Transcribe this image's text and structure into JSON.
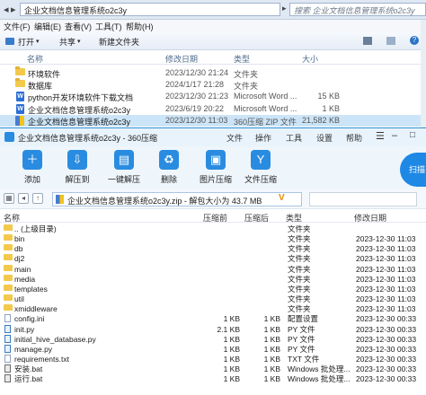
{
  "explorer": {
    "path": "企业文档信息管理系统o2c3y",
    "search_placeholder": "搜索 企业文档信息管理系统o2c3y",
    "menu": [
      "文件(F)",
      "编辑(E)",
      "查看(V)",
      "工具(T)",
      "帮助(H)"
    ],
    "toolbar": {
      "open": "打开",
      "share": "共享",
      "new_folder": "新建文件夹"
    },
    "columns": {
      "name": "名称",
      "date": "修改日期",
      "type": "类型",
      "size": "大小"
    },
    "rows": [
      {
        "name": "环境软件",
        "date": "2023/12/30 21:24",
        "type": "文件夹",
        "size": "",
        "icon": "folder-icon"
      },
      {
        "name": "数据库",
        "date": "2024/1/17 21:28",
        "type": "文件夹",
        "size": "",
        "icon": "folder-icon"
      },
      {
        "name": "python开发环境软件下载文档",
        "date": "2023/12/30 21:23",
        "type": "Microsoft Word ...",
        "size": "15 KB",
        "icon": "word-icon"
      },
      {
        "name": "企业文档信息管理系统o2c3y",
        "date": "2023/6/19 20:22",
        "type": "Microsoft Word ...",
        "size": "1 KB",
        "icon": "word-icon"
      },
      {
        "name": "企业文档信息管理系统o2c3y",
        "date": "2023/12/30 11:03",
        "type": "360压缩 ZIP 文件",
        "size": "21,582 KB",
        "icon": "zip-icon",
        "selected": true
      }
    ]
  },
  "zip": {
    "title": "企业文档信息管理系统o2c3y - 360压缩",
    "menu": [
      "文件",
      "操作",
      "工具",
      "设置",
      "帮助"
    ],
    "tools": [
      {
        "label": "添加",
        "icon": "add-icon"
      },
      {
        "label": "解压到",
        "icon": "extract-to-icon"
      },
      {
        "label": "一键解压",
        "icon": "one-click-extract-icon"
      },
      {
        "label": "删除",
        "icon": "delete-icon"
      },
      {
        "label": "图片压缩",
        "icon": "image-compress-icon"
      },
      {
        "label": "文件压缩",
        "icon": "file-compress-icon"
      }
    ],
    "scan_label": "扫描",
    "path": "企业文档信息管理系统o2c3y.zip - 解包大小为 43.7 MB",
    "columns": {
      "name": "名称",
      "size": "压缩前",
      "csize": "压缩后",
      "type": "类型",
      "date": "修改日期"
    },
    "rows": [
      {
        "name": ".. (上级目录)",
        "size": "",
        "csize": "",
        "type": "文件夹",
        "date": "",
        "kind": "folder"
      },
      {
        "name": "bin",
        "size": "",
        "csize": "",
        "type": "文件夹",
        "date": "2023-12-30 11:03",
        "kind": "folder"
      },
      {
        "name": "db",
        "size": "",
        "csize": "",
        "type": "文件夹",
        "date": "2023-12-30 11:03",
        "kind": "folder"
      },
      {
        "name": "dj2",
        "size": "",
        "csize": "",
        "type": "文件夹",
        "date": "2023-12-30 11:03",
        "kind": "folder"
      },
      {
        "name": "main",
        "size": "",
        "csize": "",
        "type": "文件夹",
        "date": "2023-12-30 11:03",
        "kind": "folder"
      },
      {
        "name": "media",
        "size": "",
        "csize": "",
        "type": "文件夹",
        "date": "2023-12-30 11:03",
        "kind": "folder"
      },
      {
        "name": "templates",
        "size": "",
        "csize": "",
        "type": "文件夹",
        "date": "2023-12-30 11:03",
        "kind": "folder"
      },
      {
        "name": "util",
        "size": "",
        "csize": "",
        "type": "文件夹",
        "date": "2023-12-30 11:03",
        "kind": "folder"
      },
      {
        "name": "xmiddleware",
        "size": "",
        "csize": "",
        "type": "文件夹",
        "date": "2023-12-30 11:03",
        "kind": "folder"
      },
      {
        "name": "config.ini",
        "size": "1 KB",
        "csize": "1 KB",
        "type": "配置设置",
        "date": "2023-12-30 00:33",
        "kind": "file"
      },
      {
        "name": "init.py",
        "size": "2.1 KB",
        "csize": "1 KB",
        "type": "PY 文件",
        "date": "2023-12-30 00:33",
        "kind": "py"
      },
      {
        "name": "initial_hive_database.py",
        "size": "1 KB",
        "csize": "1 KB",
        "type": "PY 文件",
        "date": "2023-12-30 00:33",
        "kind": "py"
      },
      {
        "name": "manage.py",
        "size": "1 KB",
        "csize": "1 KB",
        "type": "PY 文件",
        "date": "2023-12-30 00:33",
        "kind": "py"
      },
      {
        "name": "requirements.txt",
        "size": "1 KB",
        "csize": "1 KB",
        "type": "TXT 文件",
        "date": "2023-12-30 00:33",
        "kind": "file"
      },
      {
        "name": "安装.bat",
        "size": "1 KB",
        "csize": "1 KB",
        "type": "Windows 批处理...",
        "date": "2023-12-30 00:33",
        "kind": "bat"
      },
      {
        "name": "运行.bat",
        "size": "1 KB",
        "csize": "1 KB",
        "type": "Windows 批处理...",
        "date": "2023-12-30 00:33",
        "kind": "bat"
      }
    ]
  }
}
